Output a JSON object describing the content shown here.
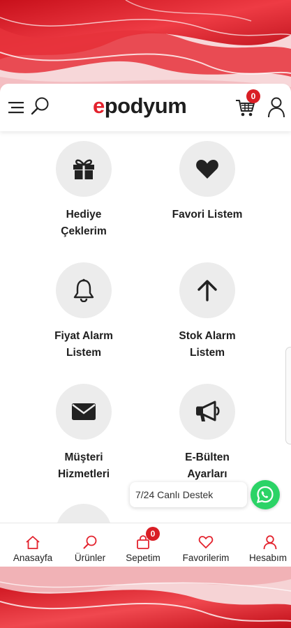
{
  "colors": {
    "brand_red": "#e3222d",
    "tile_bg": "#ececec",
    "whatsapp_green": "#2bd366"
  },
  "header": {
    "logo_first": "e",
    "logo_rest": "podyum",
    "cart_count": "0",
    "icons": [
      "menu-icon",
      "search-icon",
      "cart-icon",
      "user-icon"
    ]
  },
  "tiles": [
    {
      "label": "Hediye\nÇeklerim",
      "icon": "gift-icon"
    },
    {
      "label": "Favori Listem",
      "icon": "heart-icon"
    },
    {
      "label": "Fiyat Alarm\nListem",
      "icon": "bell-icon"
    },
    {
      "label": "Stok Alarm\nListem",
      "icon": "arrow-up-icon"
    },
    {
      "label": "Müşteri\nHizmetleri",
      "icon": "envelope-icon"
    },
    {
      "label": "E-Bülten\nAyarları",
      "icon": "megaphone-icon"
    }
  ],
  "support": {
    "label": "7/24 Canlı Destek",
    "icon": "whatsapp-icon"
  },
  "bottom_nav": {
    "cart_badge": "0",
    "items": [
      {
        "label": "Anasayfa",
        "icon": "home-icon"
      },
      {
        "label": "Ürünler",
        "icon": "search-icon"
      },
      {
        "label": "Sepetim",
        "icon": "bag-icon"
      },
      {
        "label": "Favorilerim",
        "icon": "heart-outline-icon"
      },
      {
        "label": "Hesabım",
        "icon": "user-icon"
      }
    ]
  }
}
